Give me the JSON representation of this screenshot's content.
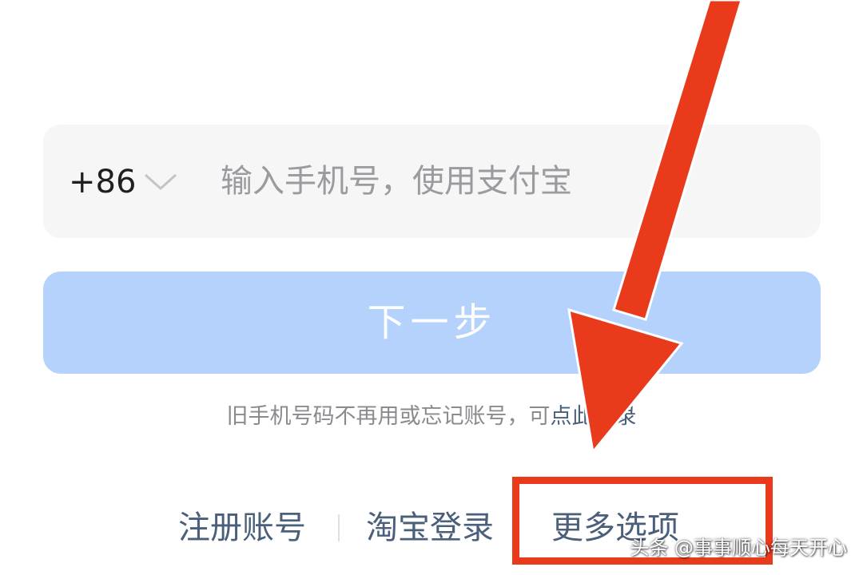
{
  "login": {
    "phone_field": {
      "country_code": "+86",
      "placeholder": "输入手机号，使用支付宝",
      "value": ""
    },
    "next_button_label": "下一步",
    "hint": {
      "text": "旧手机号码不再用或忘记账号，可",
      "link": "点此登录"
    },
    "bottom_links": {
      "register": "注册账号",
      "taobao": "淘宝登录",
      "more_options": "更多选项"
    }
  },
  "annotations": {
    "arrow_color": "#ea3a1c",
    "highlight_color": "#ea3a1c"
  },
  "watermark": "头条 @事事顺心每天开心",
  "colors": {
    "next_button_bg": "#b4d2fb",
    "link_color": "#4a5f7a",
    "field_bg": "#f6f6f7"
  }
}
